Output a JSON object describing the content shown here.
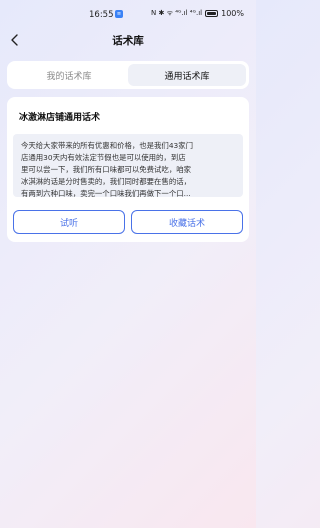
{
  "status_bar": {
    "time": "16:55",
    "badge": "≡",
    "network_text": "N ✱ ᯤ ⁴ᴳ.ıl ⁴ᴳ.ıl",
    "battery_percent": "100%"
  },
  "nav": {
    "title": "话术库",
    "back_icon": "chevron-left-icon"
  },
  "tabs": [
    {
      "label": "我的话术库",
      "active": false
    },
    {
      "label": "通用话术库",
      "active": true
    }
  ],
  "card": {
    "title": "冰激淋店铺通用话术",
    "script_lines": [
      "今天给大家带来的所有优惠和价格，也是我们43家门",
      "店通用30天内有效法定节假也是可以使用的，到店",
      "里可以尝一下，我们所有口味都可以免费试吃，咱家",
      "冰淇淋的话是分时售卖的，我们同时都要在售的话，",
      "有两到六种口味，卖完一个口味我们再做下一个口..."
    ],
    "listen_button": "试听",
    "collect_button": "收藏话术"
  },
  "colors": {
    "accent": "#4a72e8",
    "card_bg": "#ffffff",
    "script_bg": "#eef0f7"
  }
}
